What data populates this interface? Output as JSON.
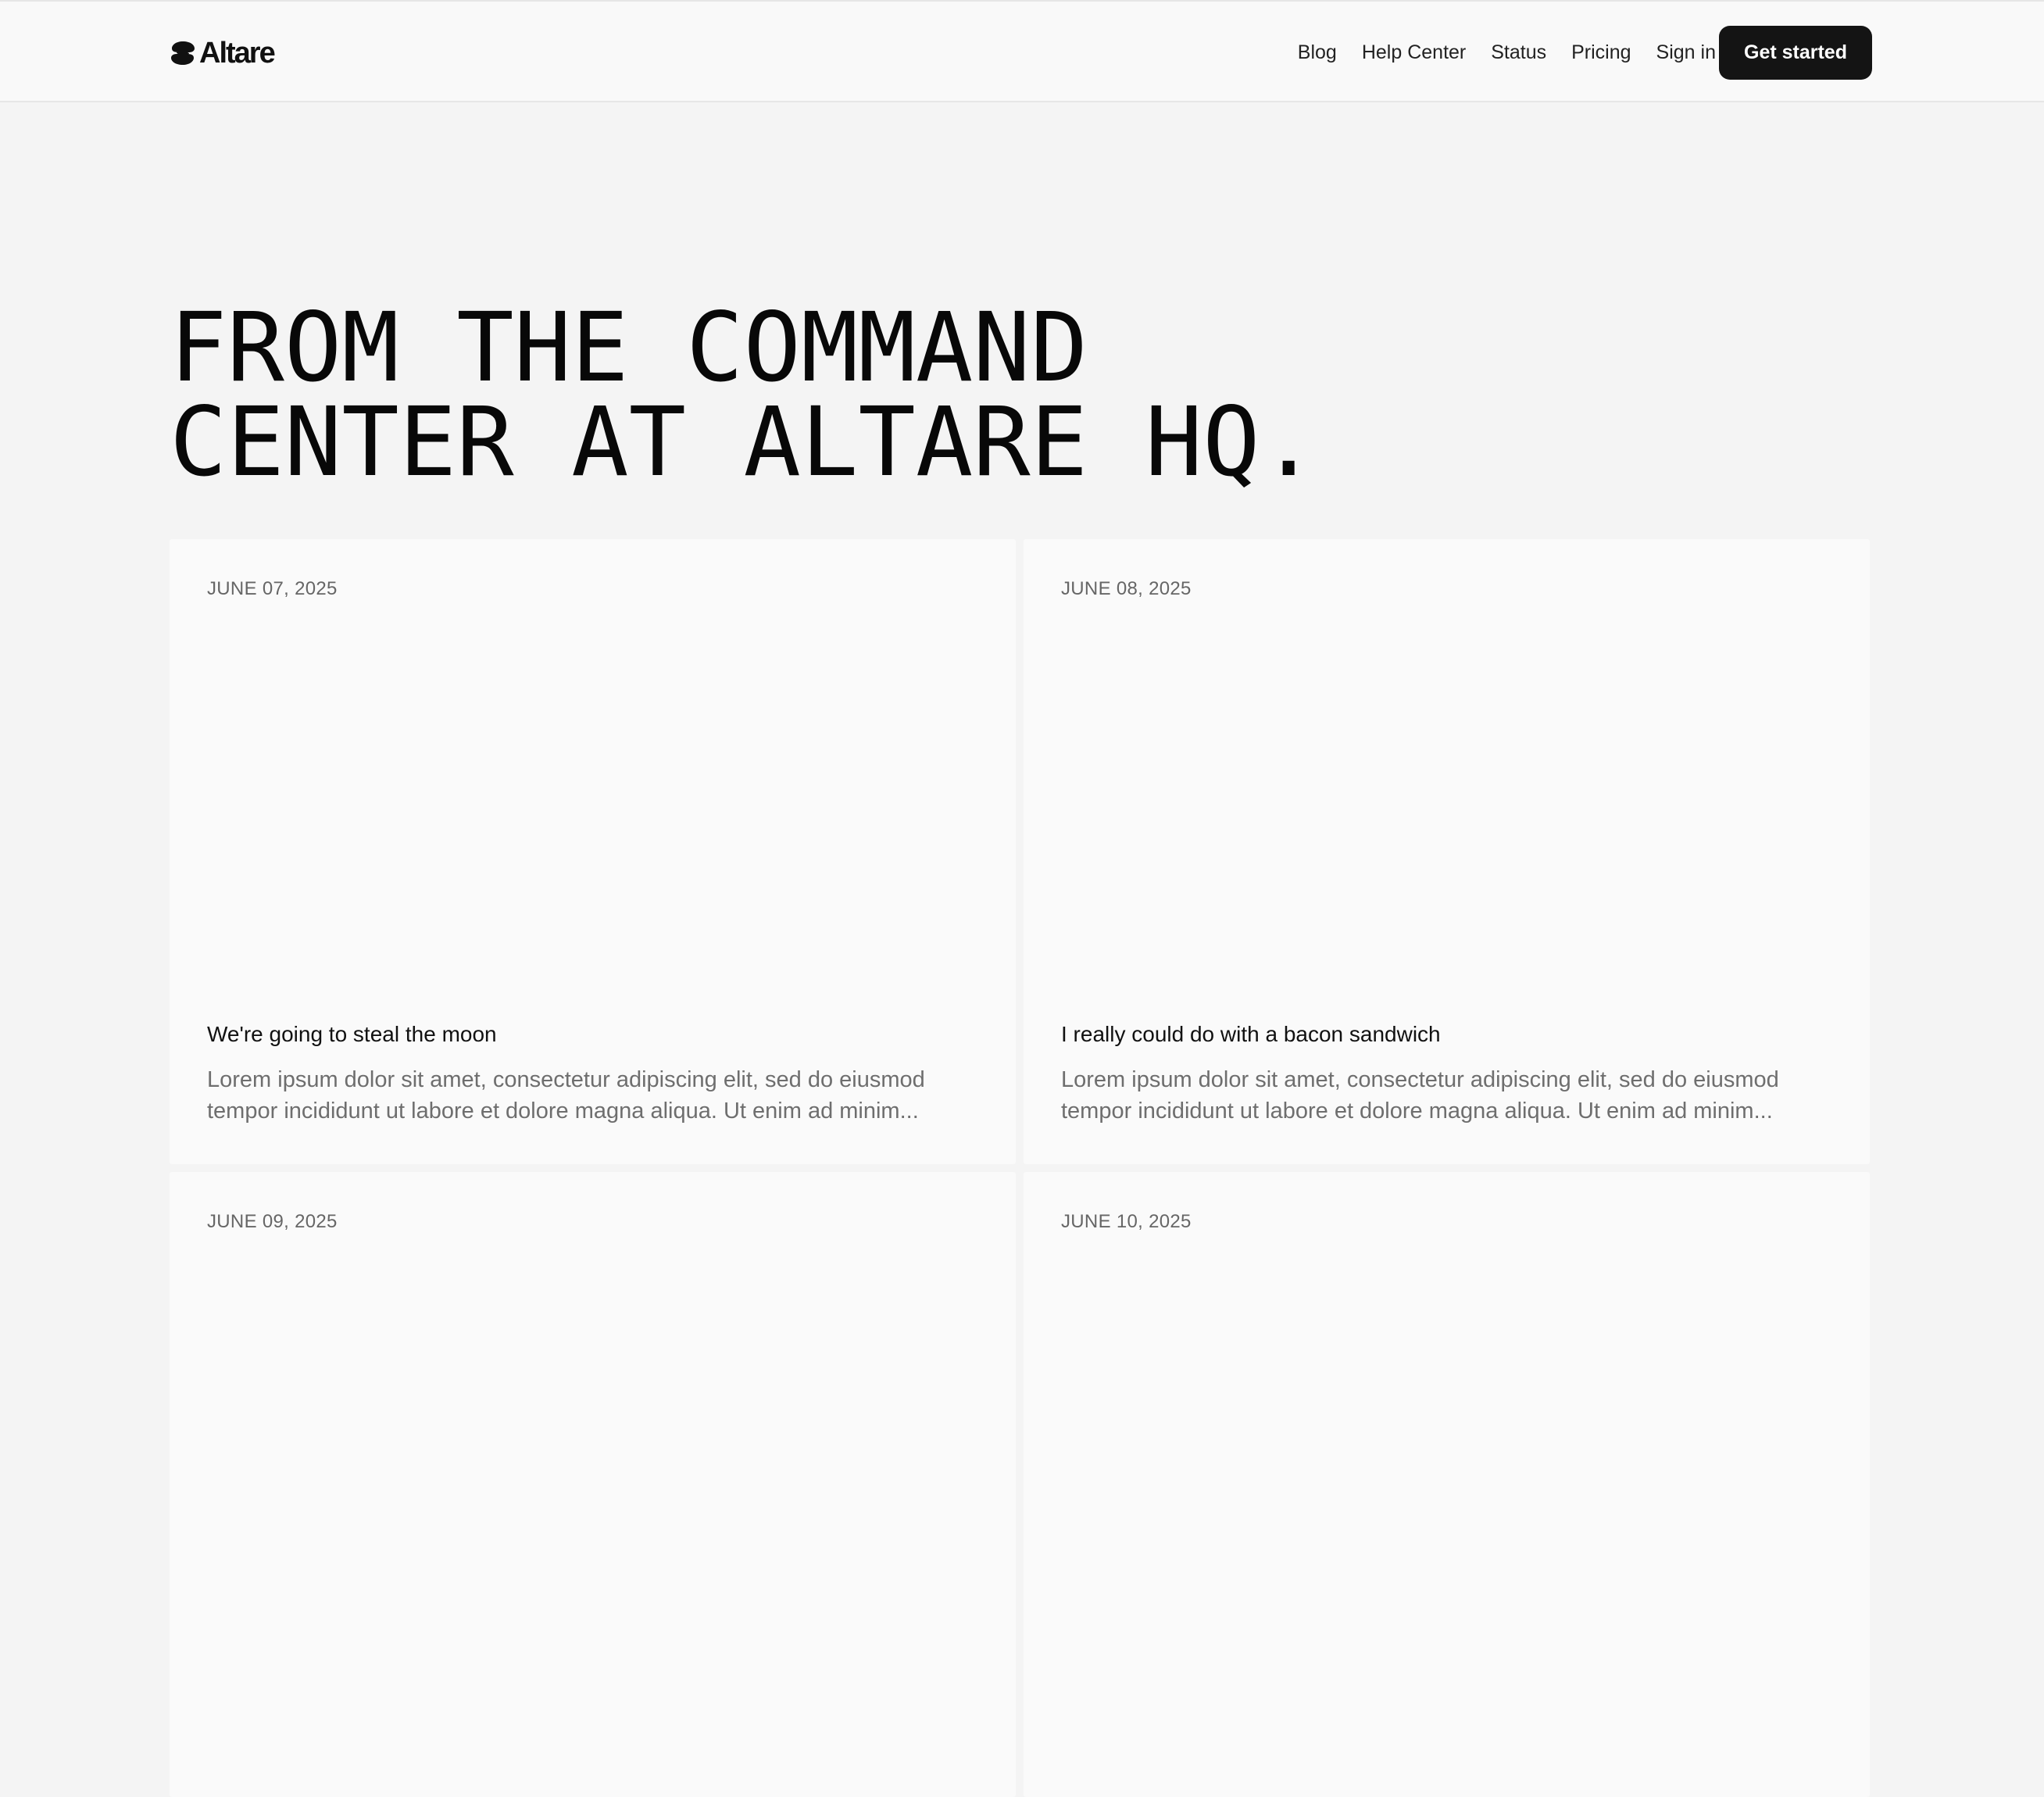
{
  "brand": {
    "name": "Altare",
    "logo_icon": "altare-s-logo-icon"
  },
  "nav": {
    "links": [
      "Blog",
      "Help Center",
      "Status",
      "Pricing",
      "Sign in"
    ],
    "cta_label": "Get started"
  },
  "hero": {
    "line1": "FROM THE COMMAND",
    "line2": "CENTER AT ALTARE HQ."
  },
  "posts": [
    {
      "date": "JUNE 07, 2025",
      "title": "We're going to steal the moon",
      "excerpt": "Lorem ipsum dolor sit amet, consectetur adipiscing elit, sed do eiusmod tempor incididunt ut labore et dolore magna aliqua. Ut enim ad minim..."
    },
    {
      "date": "JUNE 08, 2025",
      "title": "I really could do with a bacon sandwich",
      "excerpt": "Lorem ipsum dolor sit amet, consectetur adipiscing elit, sed do eiusmod tempor incididunt ut labore et dolore magna aliqua. Ut enim ad minim..."
    },
    {
      "date": "JUNE 09, 2025",
      "title": "",
      "excerpt": ""
    },
    {
      "date": "JUNE 10, 2025",
      "title": "",
      "excerpt": ""
    }
  ],
  "colors": {
    "page_background": "#f4f4f4",
    "header_background": "#f9f9f9",
    "card_background": "#fafafa",
    "cta_background": "#141414",
    "cta_text": "#ffffff",
    "muted_text": "#6e6e6e"
  }
}
